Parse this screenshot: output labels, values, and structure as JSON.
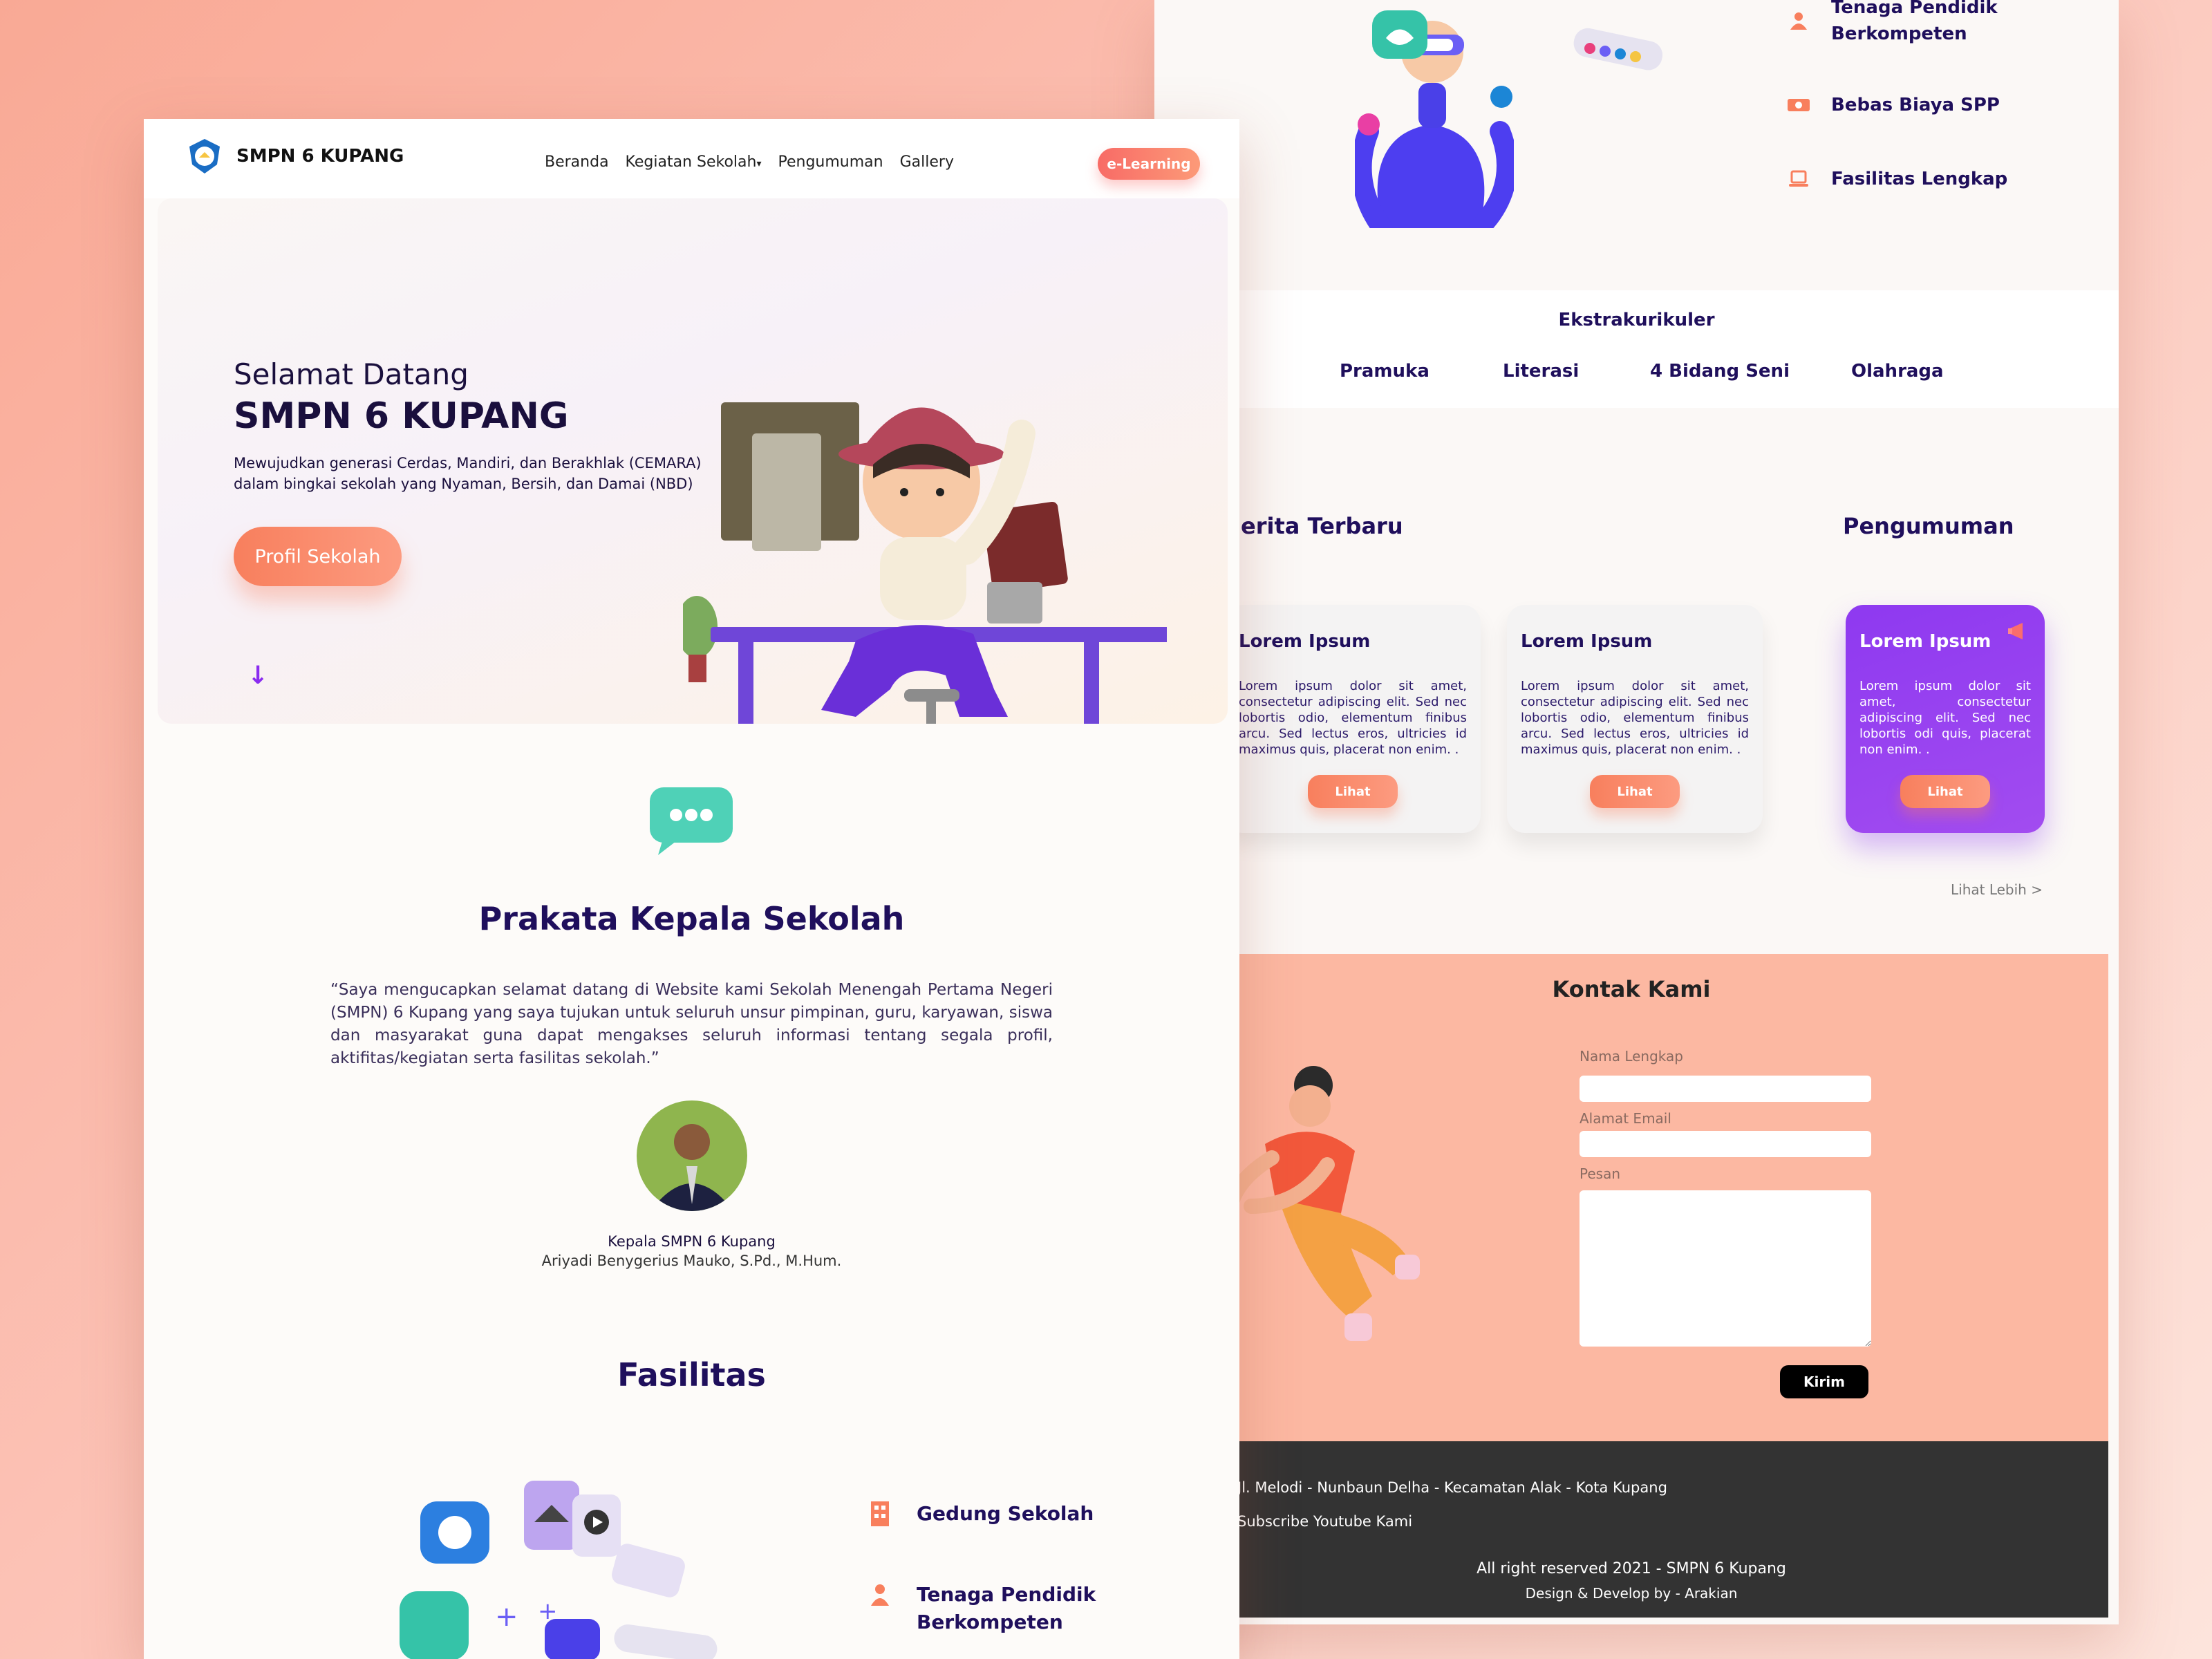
{
  "right": {
    "features": [
      {
        "icon": "teacher-icon",
        "label": "Tenaga Pendidik Berkompeten"
      },
      {
        "icon": "money-icon",
        "label": "Bebas Biaya SPP"
      },
      {
        "icon": "laptop-icon",
        "label": "Fasilitas Lengkap"
      }
    ],
    "ekskul": {
      "title": "Ekstrakurikuler",
      "items": [
        "Pramuka",
        "Literasi",
        "4 Bidang Seni",
        "Olahraga"
      ]
    },
    "berita_title": "erita Terbaru",
    "pengumuman_title": "Pengumuman",
    "cards": [
      {
        "title": "Lorem Ipsum",
        "text": "Lorem ipsum dolor sit amet, consectetur adipiscing elit. Sed nec lobortis odio, elementum finibus arcu. Sed lectus eros, ultricies id maximus quis, placerat non enim. .",
        "button": "Lihat"
      },
      {
        "title": "Lorem Ipsum",
        "text": "Lorem ipsum dolor sit amet, consectetur adipiscing elit. Sed nec lobortis odio, elementum finibus arcu. Sed lectus eros, ultricies id maximus quis, placerat non enim. .",
        "button": "Lihat"
      },
      {
        "title": "Lorem Ipsum",
        "text": "Lorem ipsum dolor sit amet, consectetur adipiscing elit. Sed nec lobortis odi quis, placerat non enim. .",
        "button": "Lihat"
      }
    ],
    "lihat_lebih": "Lihat Lebih >",
    "kontak": {
      "title": "Kontak Kami",
      "nama_label": "Nama Lengkap",
      "email_label": "Alamat Email",
      "pesan_label": "Pesan",
      "kirim": "Kirim"
    },
    "footer": {
      "address": "Jl. Melodi - Nunbaun Delha - Kecamatan Alak - Kota Kupang",
      "subscribe": "Subscribe Youtube Kami",
      "rights": "All right reserved 2021 - SMPN 6 Kupang",
      "credit": "Design & Develop by - Arakian"
    }
  },
  "left": {
    "brand": "SMPN 6 KUPANG",
    "menu": [
      "Beranda",
      "Kegiatan Sekolah",
      "Pengumuman",
      "Gallery"
    ],
    "menu_caret": "▾",
    "elearning": "e-Learning",
    "hero": {
      "greet": "Selamat Datang",
      "school": "SMPN 6 KUPANG",
      "tagline": "Mewujudkan generasi Cerdas, Mandiri, dan Berakhlak (CEMARA) dalam bingkai sekolah yang Nyaman, Bersih, dan Damai (NBD)",
      "button": "Profil Sekolah",
      "arrow": "↓"
    },
    "prakata": {
      "title": "Prakata Kepala Sekolah",
      "quote": "“Saya mengucapkan selamat datang di Website kami Sekolah Menengah Pertama Negeri (SMPN) 6 Kupang yang saya tujukan untuk seluruh unsur pimpinan, guru, karyawan, siswa dan masyarakat guna dapat mengakses seluruh informasi tentang segala profil, aktifitas/kegiatan serta fasilitas sekolah.”",
      "role": "Kepala SMPN 6 Kupang",
      "name": "Ariyadi Benygerius Mauko, S.Pd., M.Hum."
    },
    "fasilitas": {
      "title": "Fasilitas",
      "items": [
        {
          "icon": "building-icon",
          "label": "Gedung Sekolah"
        },
        {
          "icon": "teacher-icon",
          "label": "Tenaga Pendidik Berkompeten"
        }
      ]
    }
  },
  "colors": {
    "navy": "#1f0f5c",
    "accent": "#f87f5d",
    "purple": "#8e39f0",
    "salmon": "#fcb8a2"
  }
}
